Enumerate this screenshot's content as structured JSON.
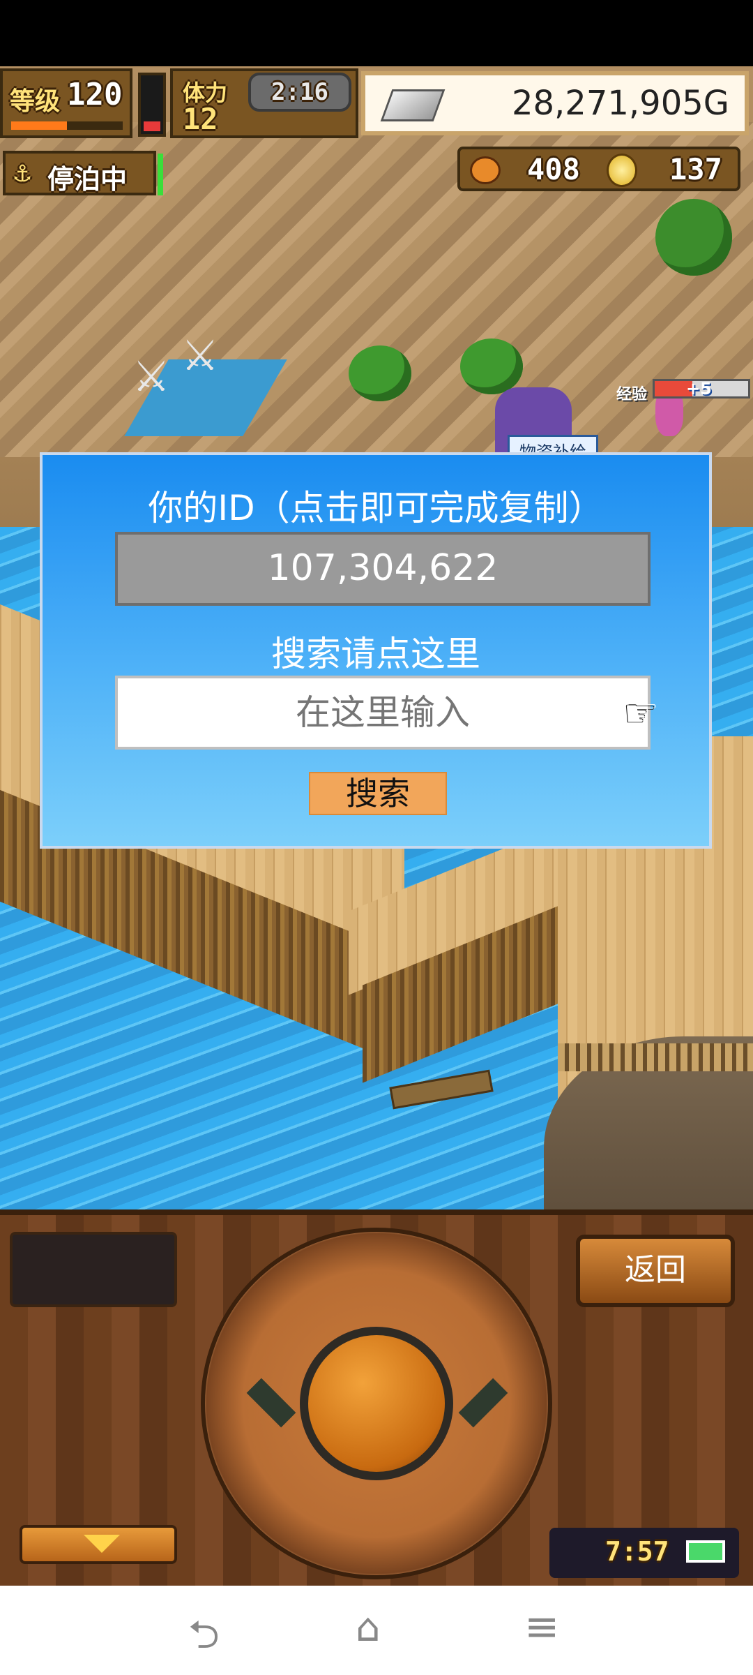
{
  "hud": {
    "level_label": "等级",
    "level_value": "120",
    "stamina_label": "体力",
    "stamina_value": "12",
    "timer": "2:16",
    "money": "28,271,905G",
    "status": "停泊中",
    "resource_1": "408",
    "resource_2": "137",
    "exp_label": "经验",
    "exp_value": "+5",
    "npc_sign": "物资补给"
  },
  "dialog": {
    "id_label": "你的ID（点击即可完成复制）",
    "id_value": "107,304,622",
    "search_hint": "搜索请点这里",
    "search_placeholder": "在这里输入",
    "search_button": "搜索"
  },
  "controller": {
    "back_button": "返回",
    "clock": "7:57"
  },
  "colors": {
    "dialog_blue": "#1a8cf0",
    "search_button": "#f2a65a",
    "battery_green": "#4ad86a"
  },
  "icons": {
    "anchor": "anchor-icon",
    "wrench": "silver-bar-icon",
    "coin": "coin-icon",
    "hand": "pointing-hand-icon"
  }
}
